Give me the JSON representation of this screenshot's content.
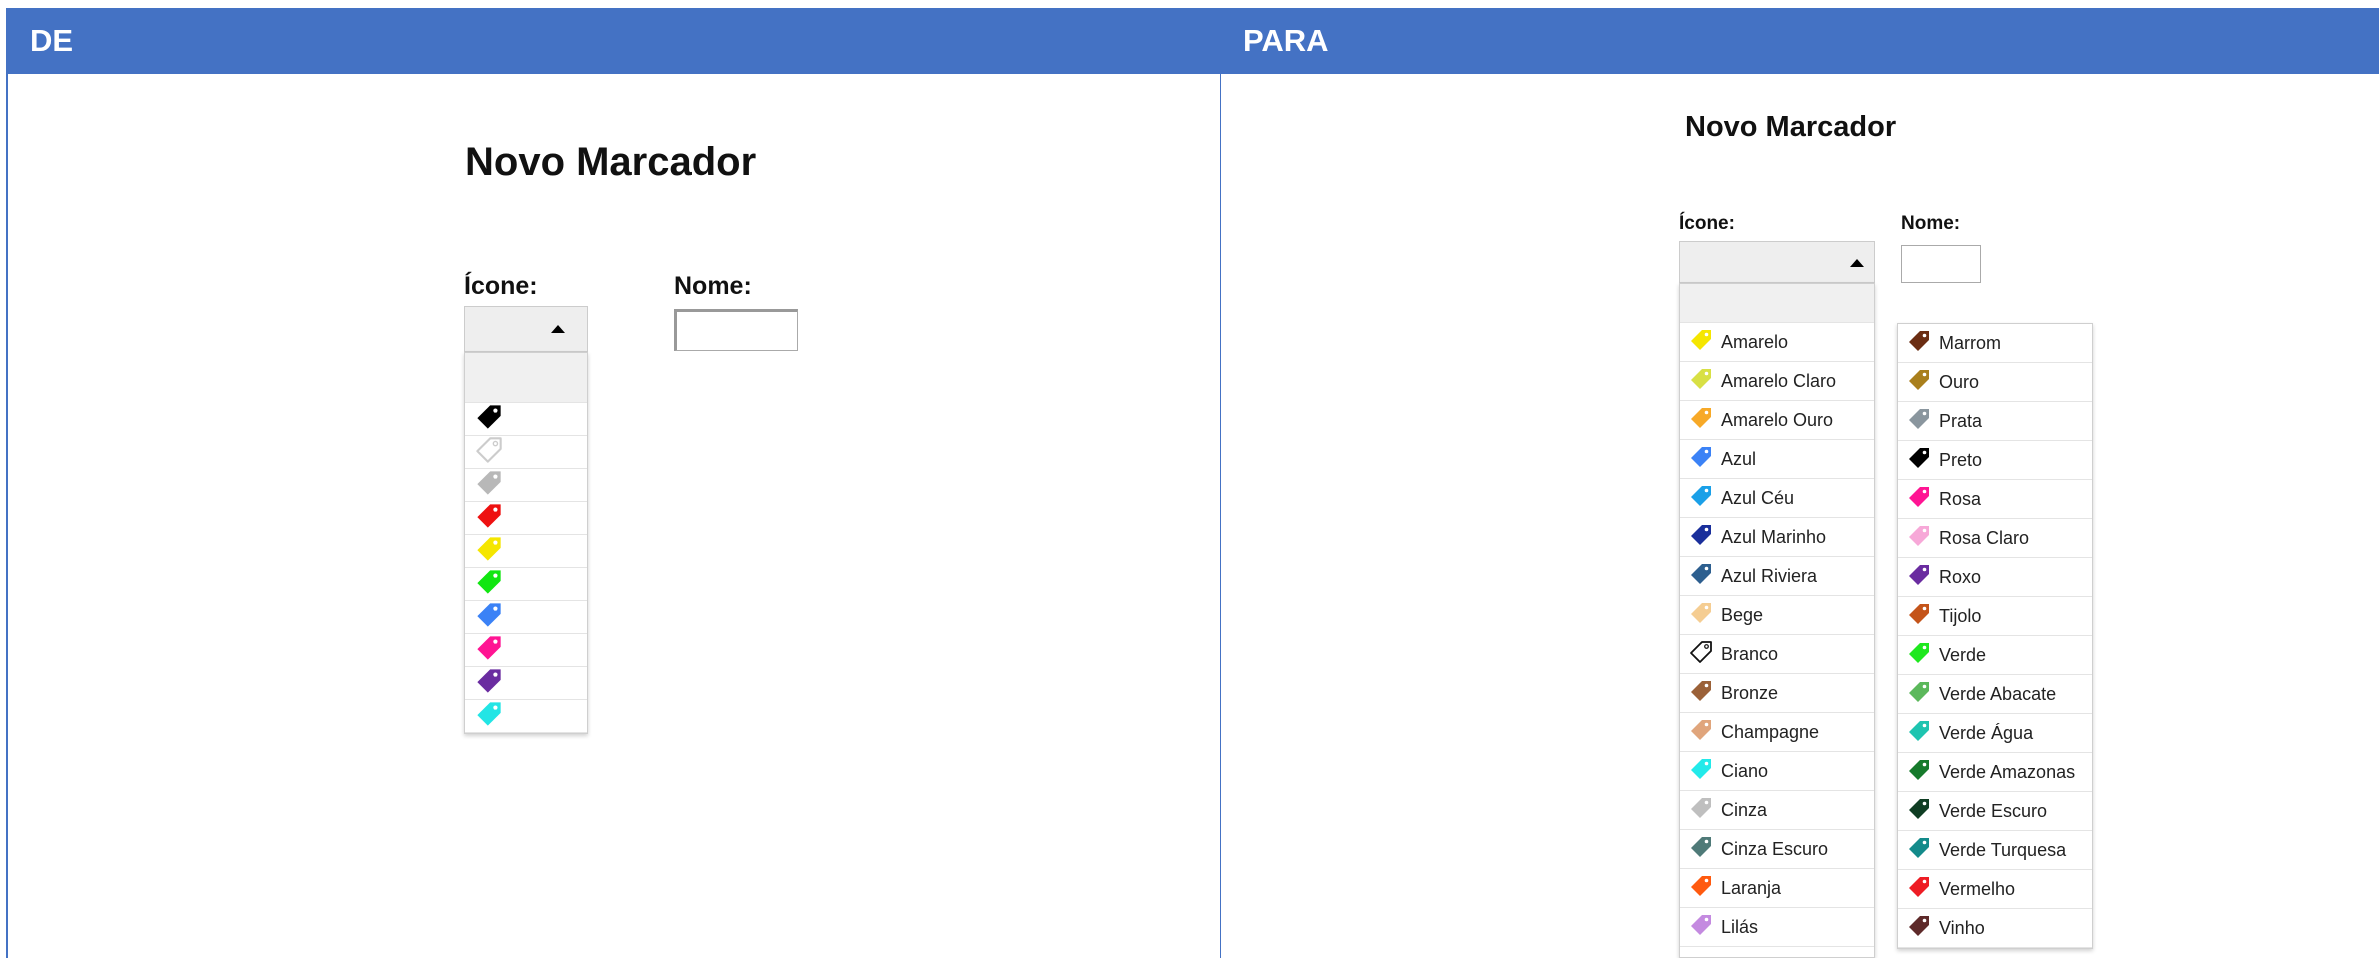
{
  "de": {
    "header": "DE",
    "title": "Novo Marcador",
    "icon_label": "Ícone:",
    "name_label": "Nome:",
    "name_value": "",
    "icons": [
      {
        "icon": "tag-icon",
        "color": "#000000"
      },
      {
        "icon": "tag-outline-icon",
        "color": "#cccccc"
      },
      {
        "icon": "tag-icon",
        "color": "#b8b8b8"
      },
      {
        "icon": "tag-icon",
        "color": "#ee1111"
      },
      {
        "icon": "tag-icon",
        "color": "#f5e600"
      },
      {
        "icon": "tag-icon",
        "color": "#11e611"
      },
      {
        "icon": "tag-icon",
        "color": "#3b82f6"
      },
      {
        "icon": "tag-icon",
        "color": "#ff1493"
      },
      {
        "icon": "tag-icon",
        "color": "#6a2ca0"
      },
      {
        "icon": "tag-icon",
        "color": "#22e5e5"
      }
    ]
  },
  "para": {
    "header": "PARA",
    "title": "Novo Marcador",
    "icon_label": "Ícone:",
    "name_label": "Nome:",
    "name_value": "",
    "col1": [
      {
        "label": "Amarelo",
        "color": "#f5e600"
      },
      {
        "label": "Amarelo Claro",
        "color": "#d8e045"
      },
      {
        "label": "Amarelo Ouro",
        "color": "#f7a928"
      },
      {
        "label": "Azul",
        "color": "#3b82f6"
      },
      {
        "label": "Azul Céu",
        "color": "#1aa0e8"
      },
      {
        "label": "Azul Marinho",
        "color": "#1a2f9b"
      },
      {
        "label": "Azul Riviera",
        "color": "#2d5f8f"
      },
      {
        "label": "Bege",
        "color": "#f5cd92"
      },
      {
        "label": "Branco",
        "color": "#ffffff"
      },
      {
        "label": "Bronze",
        "color": "#9b6138"
      },
      {
        "label": "Champagne",
        "color": "#e0a57c"
      },
      {
        "label": "Ciano",
        "color": "#22eaea"
      },
      {
        "label": "Cinza",
        "color": "#bfbfbf"
      },
      {
        "label": "Cinza Escuro",
        "color": "#4f7a78"
      },
      {
        "label": "Laranja",
        "color": "#ff5a0f"
      },
      {
        "label": "Lilás",
        "color": "#c48ae0"
      }
    ],
    "col2": [
      {
        "label": "Marrom",
        "color": "#6b2d12"
      },
      {
        "label": "Ouro",
        "color": "#a97f1c"
      },
      {
        "label": "Prata",
        "color": "#8a969e"
      },
      {
        "label": "Preto",
        "color": "#000000"
      },
      {
        "label": "Rosa",
        "color": "#ff1493"
      },
      {
        "label": "Rosa Claro",
        "color": "#f7a8d8"
      },
      {
        "label": "Roxo",
        "color": "#6a2ca0"
      },
      {
        "label": "Tijolo",
        "color": "#c4541a"
      },
      {
        "label": "Verde",
        "color": "#1ee81e"
      },
      {
        "label": "Verde Abacate",
        "color": "#5bb85b"
      },
      {
        "label": "Verde Água",
        "color": "#1ec4b0"
      },
      {
        "label": "Verde Amazonas",
        "color": "#167a2c"
      },
      {
        "label": "Verde Escuro",
        "color": "#0f3d23"
      },
      {
        "label": "Verde Turquesa",
        "color": "#138a8a"
      },
      {
        "label": "Vermelho",
        "color": "#ee1c24"
      },
      {
        "label": "Vinho",
        "color": "#5e2a2a"
      }
    ]
  }
}
